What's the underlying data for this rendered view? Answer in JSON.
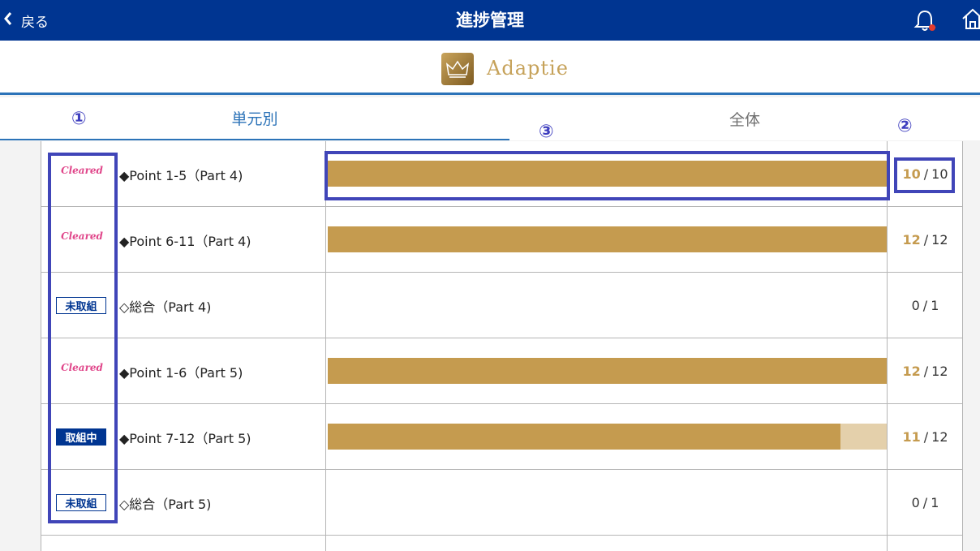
{
  "header": {
    "back_label": "戻る",
    "title": "進捗管理",
    "bell_icon": "bell-icon",
    "home_icon": "home-icon",
    "accent": "#003591",
    "notify_color": "#e53b2c"
  },
  "brand": {
    "name": "Adaptie"
  },
  "tabs": [
    {
      "label": "単元別"
    },
    {
      "label": "全体"
    }
  ],
  "annotations": [
    {
      "label": "①"
    },
    {
      "label": "②"
    },
    {
      "label": "③"
    }
  ],
  "rows": [
    {
      "status": "Cleared",
      "status_type": "cleared",
      "name": "◆Point 1-5（Part 4)",
      "done": "10",
      "total": "10",
      "progress": 1.0
    },
    {
      "status": "Cleared",
      "status_type": "cleared",
      "name": "◆Point 6-11（Part 4)",
      "done": "12",
      "total": "12",
      "progress": 1.0
    },
    {
      "status": "未取組",
      "status_type": "not-started",
      "name": "◇総合（Part 4)",
      "done": "0",
      "total": "1",
      "progress": 0
    },
    {
      "status": "Cleared",
      "status_type": "cleared",
      "name": "◆Point 1-6（Part 5)",
      "done": "12",
      "total": "12",
      "progress": 1.0
    },
    {
      "status": "取組中",
      "status_type": "in-progress",
      "name": "◆Point 7-12（Part 5)",
      "done": "11",
      "total": "12",
      "progress": 0.917
    },
    {
      "status": "未取組",
      "status_type": "not-started",
      "name": "◇総合（Part 5)",
      "done": "0",
      "total": "1",
      "progress": 0
    }
  ],
  "colors": {
    "bar": "#c59b4f",
    "bar_track": "#e4d0ab",
    "cleared": "#e0468a"
  }
}
